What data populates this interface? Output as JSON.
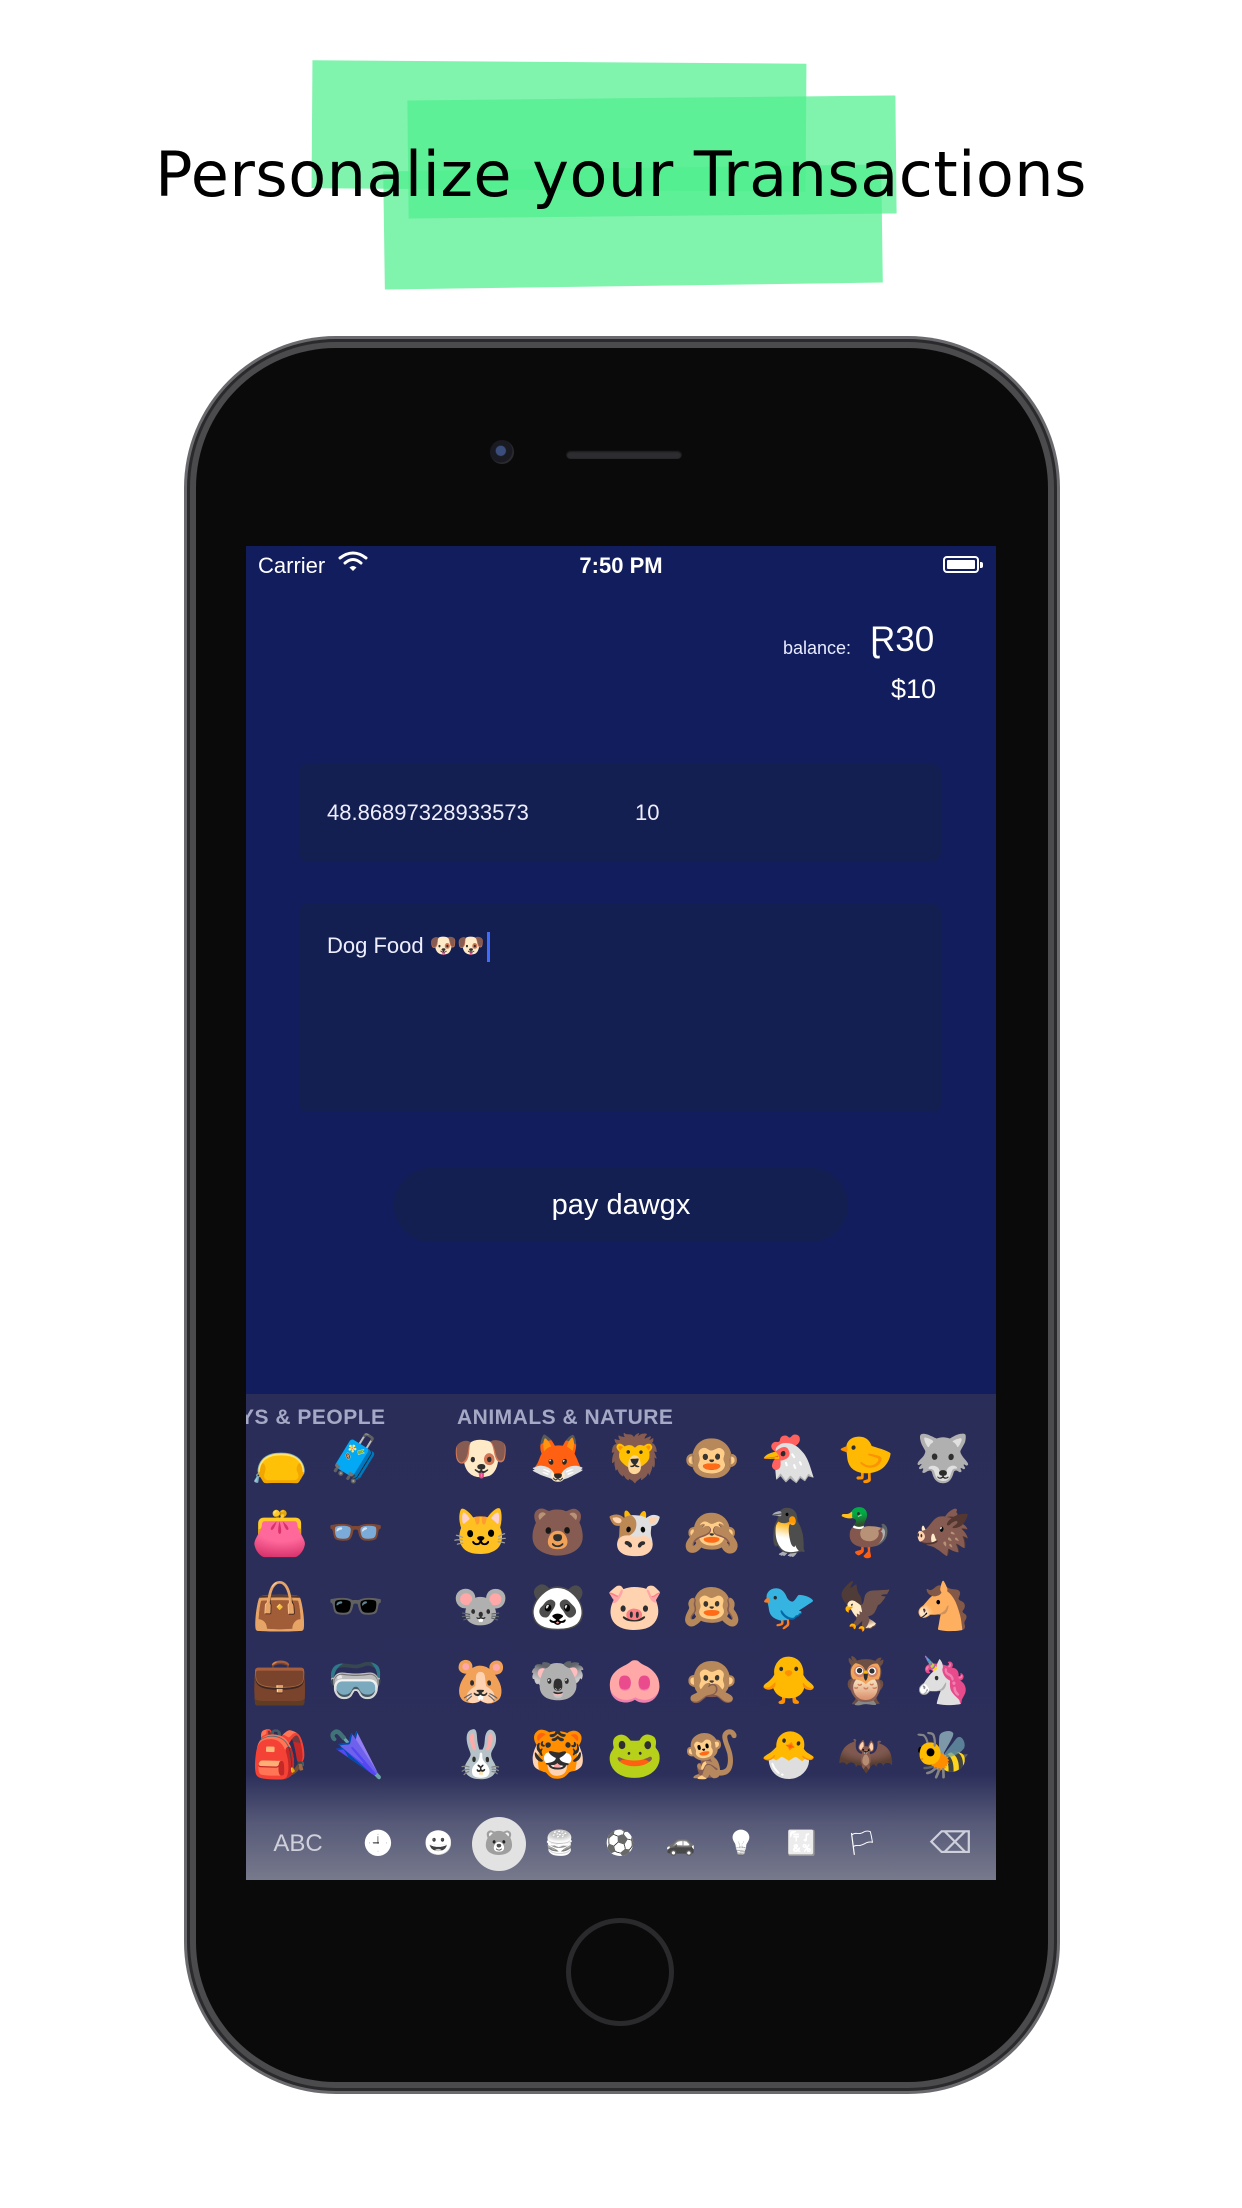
{
  "headline": "Personalize your Transactions",
  "status_bar": {
    "carrier": "Carrier",
    "time": "7:50 PM"
  },
  "balance": {
    "label": "balance:",
    "amount_main": "Ɽ30",
    "amount_usd": "$10"
  },
  "amount_field": {
    "converted_value": "48.86897328933573",
    "value": "10"
  },
  "memo_field": {
    "text": "Dog Food 🐶🐶"
  },
  "pay_button": {
    "label": "pay dawgx"
  },
  "keyboard": {
    "category_left": "YS & PEOPLE",
    "category_right": "ANIMALS & NATURE",
    "abc_label": "ABC",
    "emojis_left": [
      "👝",
      "🧳",
      "👛",
      "👓",
      "👜",
      "🕶️",
      "💼",
      "🥽",
      "🎒",
      "🌂"
    ],
    "emojis": [
      "🐶",
      "🦊",
      "🦁",
      "🐵",
      "🐔",
      "🐤",
      "🐺",
      "🐱",
      "🐻",
      "🐮",
      "🙈",
      "🐧",
      "🦆",
      "🐗",
      "🐭",
      "🐼",
      "🐷",
      "🙉",
      "🐦",
      "🦅",
      "🐴",
      "🐹",
      "🐨",
      "🐽",
      "🙊",
      "🐥",
      "🦉",
      "🦄",
      "🐰",
      "🐯",
      "🐸",
      "🐒",
      "🐣",
      "🦇",
      "🐝"
    ],
    "bar_icons": [
      "clock-icon",
      "smiley-icon",
      "bear-icon",
      "food-icon",
      "ball-icon",
      "car-icon",
      "bulb-icon",
      "symbols-icon",
      "flag-icon"
    ],
    "bar_glyphs": [
      "🕘",
      "😀",
      "🐻",
      "🍔",
      "⚽",
      "🚗",
      "💡",
      "🔣",
      "🏳"
    ],
    "delete_glyph": "⌫"
  }
}
